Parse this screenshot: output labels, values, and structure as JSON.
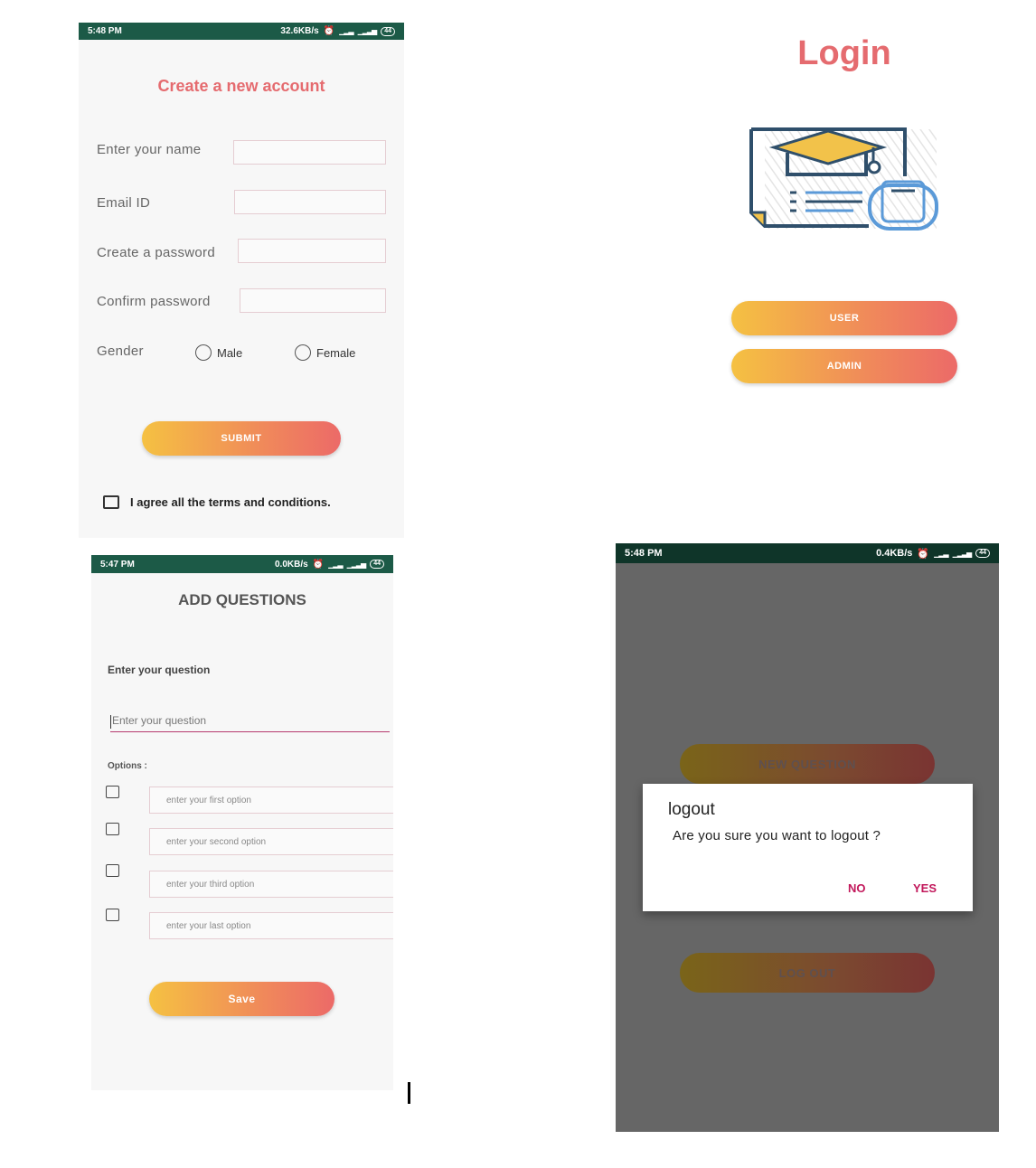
{
  "registration": {
    "status": {
      "time": "5:48 PM",
      "speed": "32.6KB/s",
      "battery": "44"
    },
    "title": "Create a new account",
    "fields": [
      {
        "label": "Enter your name",
        "value": ""
      },
      {
        "label": "Email ID",
        "value": ""
      },
      {
        "label": "Create a password",
        "value": ""
      },
      {
        "label": "Confirm password",
        "value": ""
      }
    ],
    "gender_label": "Gender",
    "gender_options": [
      "Male",
      "Female"
    ],
    "submit_label": "SUBMIT",
    "terms_label": "I agree all the terms and conditions."
  },
  "login": {
    "title": "Login",
    "user_button": "USER",
    "admin_button": "ADMIN",
    "colors": {
      "accent": "#e56b6f",
      "gradient_start": "#f5c142",
      "gradient_end": "#ec6a68"
    }
  },
  "add_questions": {
    "status": {
      "time": "5:47 PM",
      "speed": "0.0KB/s",
      "battery": "44"
    },
    "title": "ADD QUESTIONS",
    "question_label": "Enter your question",
    "question_placeholder": "Enter your question",
    "options_label": "Options :",
    "option_placeholders": [
      "enter your first option",
      "enter your second option",
      "enter your third option",
      "enter your last option"
    ],
    "save_label": "Save"
  },
  "logout_screen": {
    "status": {
      "time": "5:48 PM",
      "speed": "0.4KB/s",
      "battery": "44"
    },
    "new_question_button": "NEW QUESTION",
    "logout_button": "LOG OUT",
    "dialog": {
      "title": "logout",
      "message": "Are you sure you want to logout ?",
      "no_label": "NO",
      "yes_label": "YES"
    }
  }
}
